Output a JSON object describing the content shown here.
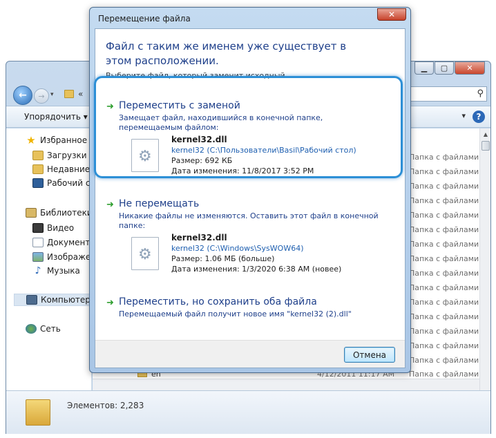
{
  "explorer": {
    "toolbar": {
      "organize": "Упорядочить ▾",
      "view": "▾"
    },
    "nav": [
      {
        "label": "Избранное",
        "icon": "star-icon"
      },
      {
        "label": "Загрузки",
        "icon": "downloads-folder-icon"
      },
      {
        "label": "Недавние места",
        "icon": "recent-places-icon"
      },
      {
        "label": "Рабочий стол",
        "icon": "desktop-icon"
      },
      {
        "label": "Библиотеки",
        "icon": "libraries-icon"
      },
      {
        "label": "Видео",
        "icon": "video-icon"
      },
      {
        "label": "Документы",
        "icon": "documents-icon"
      },
      {
        "label": "Изображения",
        "icon": "images-icon"
      },
      {
        "label": "Музыка",
        "icon": "music-icon"
      },
      {
        "label": "Компьютер",
        "icon": "computer-icon"
      },
      {
        "label": "Сеть",
        "icon": "network-icon"
      }
    ],
    "file_type": "Папка с файлами",
    "last_row": {
      "name": "en",
      "date": "4/12/2011 11:17 AM",
      "type": "Папка с файлами"
    },
    "item_count": "Элементов: 2,283"
  },
  "dialog": {
    "title": "Перемещение файла",
    "close": "✕",
    "heading": "Файл с таким же именем уже существует в этом расположении.",
    "subheading": "Выберите файл, который заменит исходный",
    "options": [
      {
        "title": "Переместить с заменой",
        "description": "Замещает файл, находившийся в конечной папке, перемещаемым файлом:",
        "file": {
          "name": "kernel32.dll",
          "path": "kernel32 (C:\\Пользователи\\Basil\\Рабочий стол)",
          "size": "Размер: 692 КБ",
          "modified": "Дата изменения: 11/8/2017 3:52 PM"
        }
      },
      {
        "title": "Не перемещать",
        "description": "Никакие файлы не изменяются. Оставить этот файл в конечной папке:",
        "file": {
          "name": "kernel32.dll",
          "path": "kernel32 (C:\\Windows\\SysWOW64)",
          "size": "Размер: 1.06 МБ (больше)",
          "modified": "Дата изменения: 1/3/2020 6:38 AM (новее)"
        }
      },
      {
        "title": "Переместить, но сохранить оба файла",
        "description": "Перемещаемый файл получит новое имя \"kernel32 (2).dll\""
      }
    ],
    "cancel_label": "Отмена"
  },
  "colors": {
    "accent_link": "#1e3f8a",
    "highlight_ring": "#2c8fd6",
    "green_arrow": "#2e9e2e"
  }
}
